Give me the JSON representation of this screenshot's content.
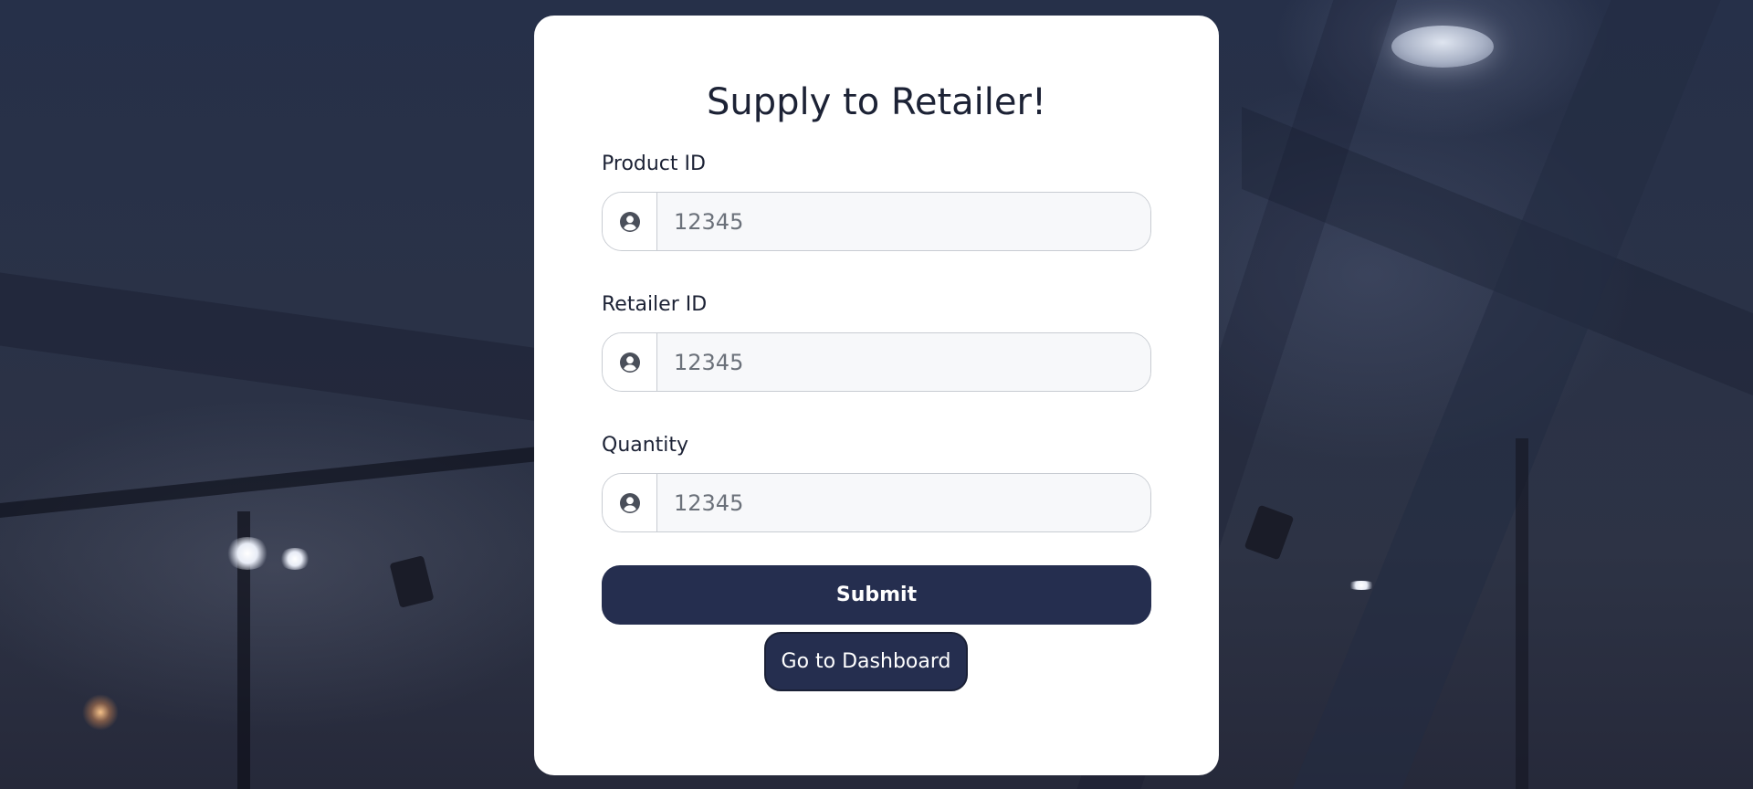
{
  "page": {
    "title": "Supply to Retailer!"
  },
  "form": {
    "fields": [
      {
        "label": "Product ID",
        "placeholder": "12345",
        "icon": "user-circle-icon"
      },
      {
        "label": "Retailer ID",
        "placeholder": "12345",
        "icon": "user-circle-icon"
      },
      {
        "label": "Quantity",
        "placeholder": "12345",
        "icon": "user-circle-icon"
      }
    ],
    "submit_label": "Submit",
    "dashboard_label": "Go to Dashboard"
  },
  "colors": {
    "accent": "#252e4f",
    "text": "#1c2235",
    "card": "#ffffff"
  }
}
